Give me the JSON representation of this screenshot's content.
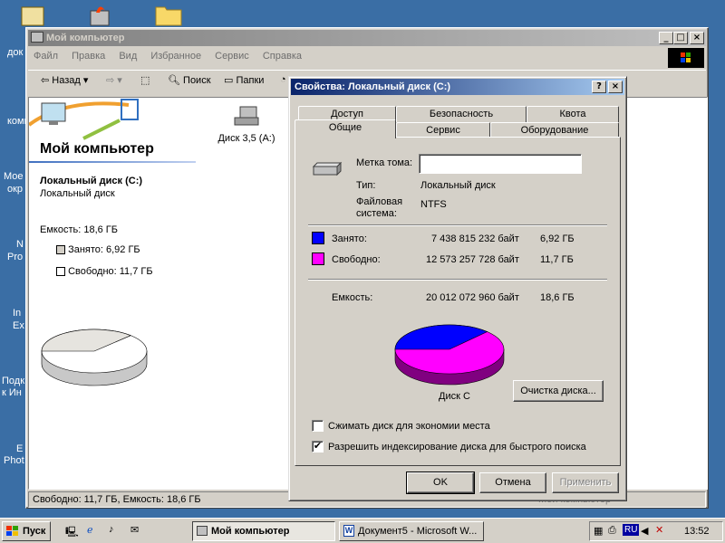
{
  "desktop": {
    "labels": [
      "док",
      "комп",
      "Мое",
      "окр",
      "N",
      "Pro",
      "In",
      "Ex",
      "Подк",
      "к Ин",
      "E",
      "Phot"
    ]
  },
  "explorer": {
    "title": "Мой компьютер",
    "menu": [
      "Файл",
      "Правка",
      "Вид",
      "Избранное",
      "Сервис",
      "Справка"
    ],
    "toolbar": {
      "back": "Назад",
      "search": "Поиск",
      "folders": "Папки"
    },
    "panel_title": "Мой компьютер",
    "drive_title": "Локальный диск (C:)",
    "drive_type": "Локальный диск",
    "capacity": "Емкость: 18,6 ГБ",
    "used": "Занято: 6,92 ГБ",
    "free": "Свободно: 11,7 ГБ",
    "floppy_label": "Диск 3,5 (A:)",
    "status": "Свободно: 11,7 ГБ, Емкость: 18,6 ГБ",
    "status_right": "Мой компьютер"
  },
  "dialog": {
    "title": "Свойства: Локальный диск (C:)",
    "tabs_back": [
      "Доступ",
      "Безопасность",
      "Квота"
    ],
    "tabs_front": [
      "Общие",
      "Сервис",
      "Оборудование"
    ],
    "label_field": "Метка тома:",
    "label_value": "",
    "type_label": "Тип:",
    "type_value": "Локальный диск",
    "fs_label": "Файловая система:",
    "fs_value": "NTFS",
    "used_label": "Занято:",
    "used_bytes": "7 438 815 232 байт",
    "used_gb": "6,92 ГБ",
    "free_label": "Свободно:",
    "free_bytes": "12 573 257 728 байт",
    "free_gb": "11,7 ГБ",
    "cap_label": "Емкость:",
    "cap_bytes": "20 012 072 960 байт",
    "cap_gb": "18,6 ГБ",
    "disk_label": "Диск C",
    "cleanup_button": "Очистка диска...",
    "compress_label": "Сжимать диск для экономии места",
    "compress_checked": false,
    "index_label": "Разрешить индексирование диска для быстрого поиска",
    "index_checked": true,
    "ok": "OK",
    "cancel": "Отмена",
    "apply": "Применить",
    "used_color": "#0000ff",
    "free_color": "#ff00ff",
    "used_fraction": 0.372
  },
  "taskbar": {
    "start": "Пуск",
    "task1": "Мой компьютер",
    "task2": "Документ5 - Microsoft W...",
    "lang": "RU",
    "clock": "13:52"
  }
}
